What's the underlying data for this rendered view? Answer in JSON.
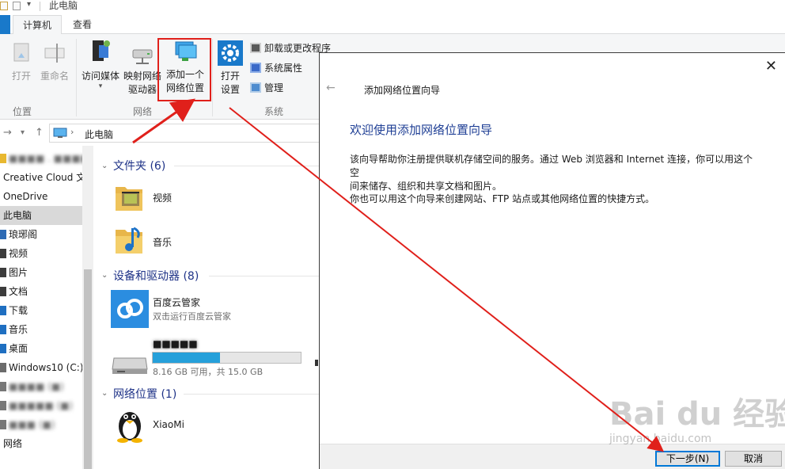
{
  "window": {
    "title": "此电脑"
  },
  "ribbon": {
    "tabs": [
      {
        "label": "计算机",
        "active": true
      },
      {
        "label": "查看",
        "active": false
      }
    ],
    "location_group": {
      "label": "位置",
      "open": "打开",
      "rename": "重命名"
    },
    "network_group": {
      "label": "网络",
      "access_media": "访问媒体",
      "map_drive_line1": "映射网络",
      "map_drive_line2": "驱动器",
      "add_location_line1": "添加一个",
      "add_location_line2": "网络位置"
    },
    "system_group": {
      "label": "系统",
      "open_settings_line1": "打开",
      "open_settings_line2": "设置",
      "uninstall": "卸载或更改程序",
      "system_properties": "系统属性",
      "manage": "管理"
    }
  },
  "address": {
    "path": "此电脑"
  },
  "nav": {
    "items": [
      {
        "label": "■■■■ . ■■■■",
        "blurred": true,
        "color": "#e8b830"
      },
      {
        "label": "Creative Cloud 文",
        "blurred": false
      },
      {
        "label": "OneDrive",
        "blurred": false
      },
      {
        "label": "此电脑",
        "blurred": false,
        "selected": true
      },
      {
        "label": "琅琊阁",
        "blurred": false,
        "color": "#2d6ab4"
      },
      {
        "label": "视频",
        "blurred": false,
        "color": "#3c3c3c"
      },
      {
        "label": "图片",
        "blurred": false,
        "color": "#3c3c3c"
      },
      {
        "label": "文档",
        "blurred": false,
        "color": "#3c3c3c"
      },
      {
        "label": "下载",
        "blurred": false,
        "color": "#1f6fc1"
      },
      {
        "label": "音乐",
        "blurred": false,
        "color": "#1f6fc1"
      },
      {
        "label": "桌面",
        "blurred": false,
        "color": "#1f6fc1"
      },
      {
        "label": "Windows10 (C:)",
        "blurred": false,
        "color": "#6b6b6b"
      },
      {
        "label": "■■■■ (■)",
        "blurred": true,
        "color": "#777"
      },
      {
        "label": "■■■■■ (■)",
        "blurred": true,
        "color": "#777"
      },
      {
        "label": "■■■ (■)",
        "blurred": true,
        "color": "#777"
      },
      {
        "label": "网络",
        "blurred": false
      }
    ]
  },
  "content": {
    "folders": {
      "title": "文件夹 (6)",
      "items": [
        {
          "label": "视频"
        },
        {
          "label": "音乐"
        }
      ]
    },
    "devices": {
      "title": "设备和驱动器 (8)",
      "baidu": {
        "label": "百度云管家",
        "sub": "双击运行百度云管家"
      },
      "drive": {
        "label": "■■■■■",
        "space": "8.16 GB 可用，共 15.0 GB",
        "used_fraction": 0.456
      }
    },
    "network": {
      "title": "网络位置 (1)",
      "items": [
        {
          "label": "XiaoMi"
        }
      ]
    }
  },
  "dialog": {
    "title": "添加网络位置向导",
    "heading": "欢迎使用添加网络位置向导",
    "para1_line1": "该向导帮助你注册提供联机存储空间的服务。通过 Web 浏览器和 Internet 连接，你可以用这个空",
    "para1_line2": "间来储存、组织和共享文档和图片。",
    "para2": "你也可以用这个向导来创建网站、FTP 站点或其他网络位置的快捷方式。",
    "next_button": "下一步(N)",
    "cancel_button": "取消"
  },
  "watermark": {
    "main": "Bai du 经验",
    "sub": "jingyan.baidu.com"
  },
  "colors": {
    "accent": "#1979ca",
    "annotation_red": "#e0201b",
    "heading_blue": "#1f3f95"
  }
}
